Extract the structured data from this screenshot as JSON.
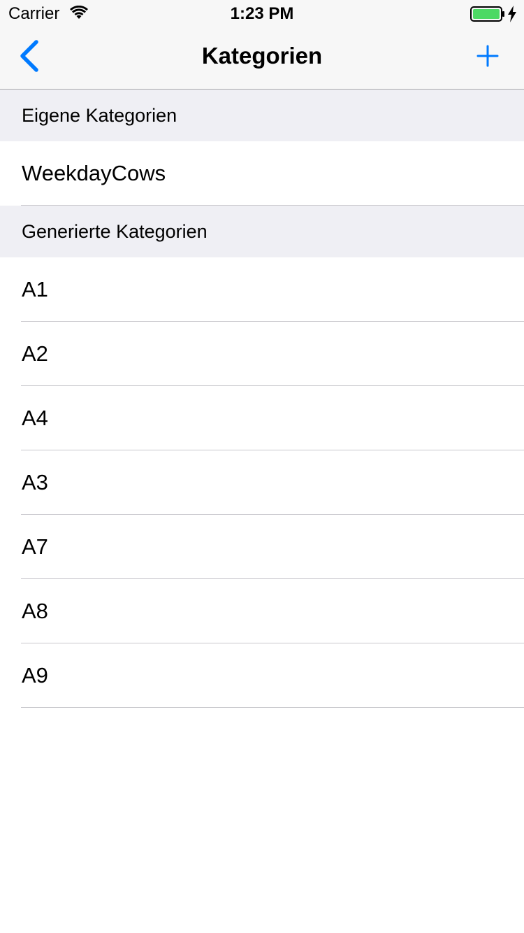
{
  "status_bar": {
    "carrier": "Carrier",
    "time": "1:23 PM",
    "battery_color": "#4cd964"
  },
  "nav_bar": {
    "title": "Kategorien",
    "back_icon": "chevron-left-icon",
    "add_icon": "plus-icon",
    "accent_color": "#007aff"
  },
  "sections": [
    {
      "header": "Eigene Kategorien",
      "rows": [
        "WeekdayCows"
      ]
    },
    {
      "header": "Generierte Kategorien",
      "rows": [
        "A1",
        "A2",
        "A4",
        "A3",
        "A7",
        "A8",
        "A9"
      ]
    }
  ]
}
